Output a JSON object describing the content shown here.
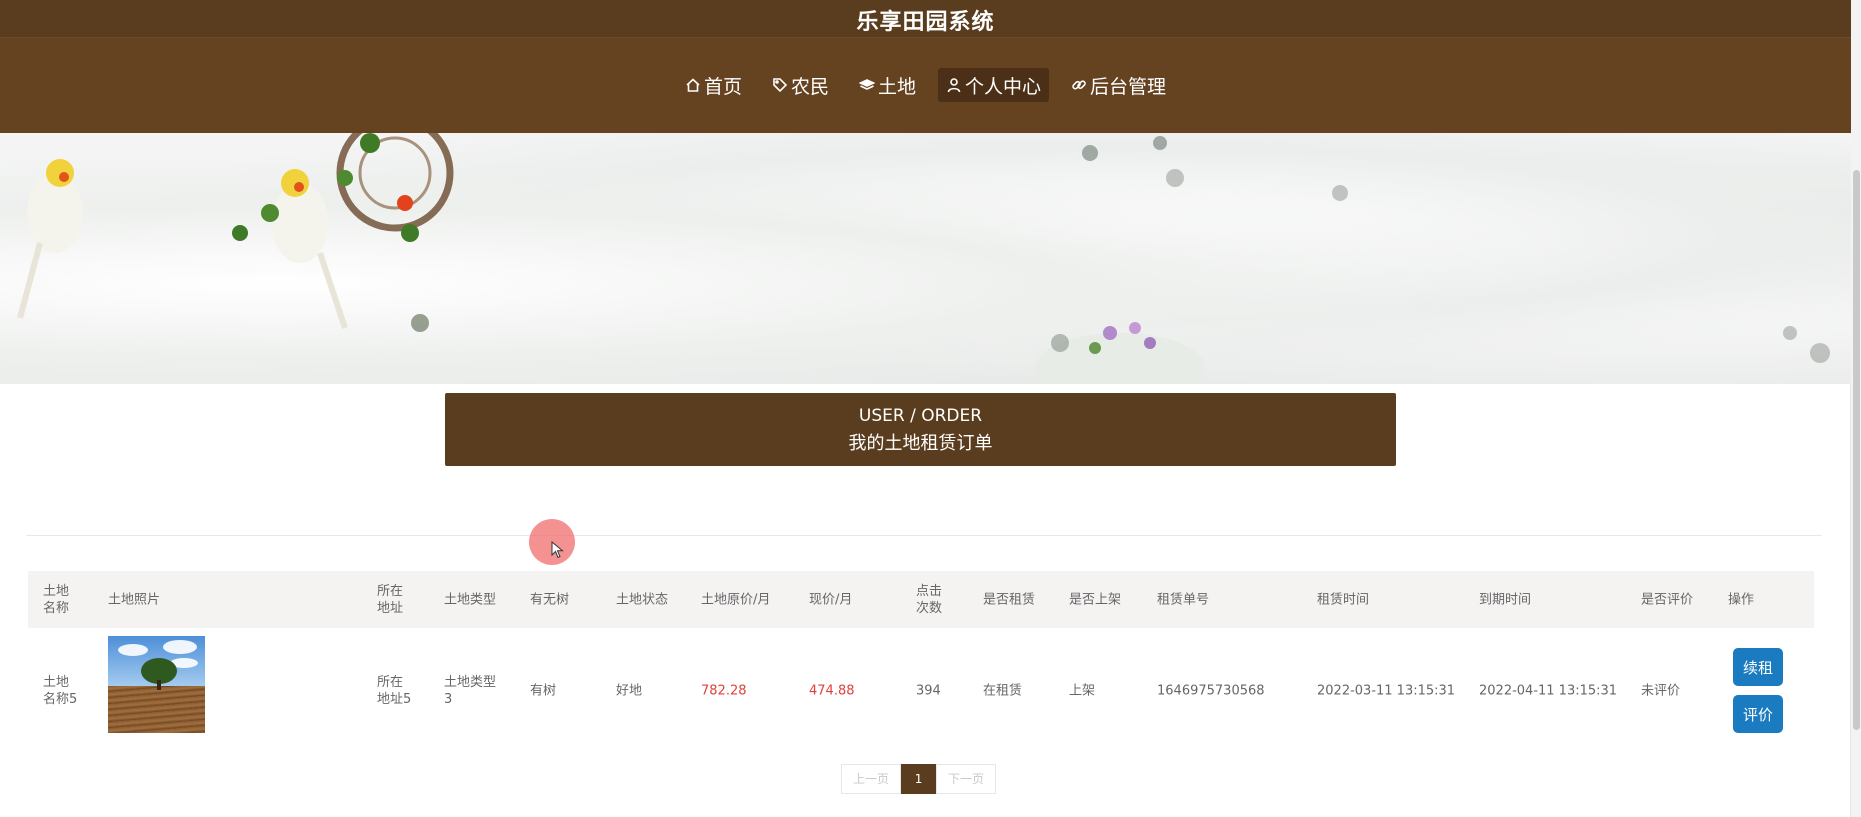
{
  "site_title": "乐享田园系统",
  "nav": [
    {
      "label": "首页",
      "icon": "home-icon"
    },
    {
      "label": "农民",
      "icon": "tag-icon"
    },
    {
      "label": "土地",
      "icon": "layers-icon"
    },
    {
      "label": "个人中心",
      "icon": "user-icon",
      "active": true
    },
    {
      "label": "后台管理",
      "icon": "link-icon"
    }
  ],
  "banner": {
    "slides": 3,
    "active_slide": 1
  },
  "section": {
    "title_en": "USER / ORDER",
    "title_cn": "我的土地租赁订单"
  },
  "table": {
    "headers": {
      "name": "土地\n名称",
      "photo": "土地照片",
      "address": "所在\n地址",
      "type": "土地类型",
      "trees": "有无树",
      "status": "土地状态",
      "orig_price": "土地原价/月",
      "price": "现价/月",
      "clicks": "点击\n次数",
      "rented": "是否租赁",
      "listed": "是否上架",
      "order_no": "租赁单号",
      "rent_time": "租赁时间",
      "expire_time": "到期时间",
      "reviewed": "是否评价",
      "action": "操作"
    },
    "rows": [
      {
        "name": "土地\n名称5",
        "address": "所在\n地址5",
        "type": "土地类型\n3",
        "trees": "有树",
        "status": "好地",
        "orig_price": "782.28",
        "price": "474.88",
        "clicks": "394",
        "rented": "在租赁",
        "listed": "上架",
        "order_no": "1646975730568",
        "rent_time": "2022-03-11 13:15:31",
        "expire_time": "2022-04-11 13:15:31",
        "reviewed": "未评价",
        "renew_label": "续租",
        "review_label": "评价"
      }
    ]
  },
  "pagination": {
    "prev": "上一页",
    "current": "1",
    "next": "下一页"
  },
  "colors": {
    "brand": "#5a3c1e",
    "nav_bg": "#654220",
    "button": "#1a7bc0",
    "price": "#e0413b"
  }
}
